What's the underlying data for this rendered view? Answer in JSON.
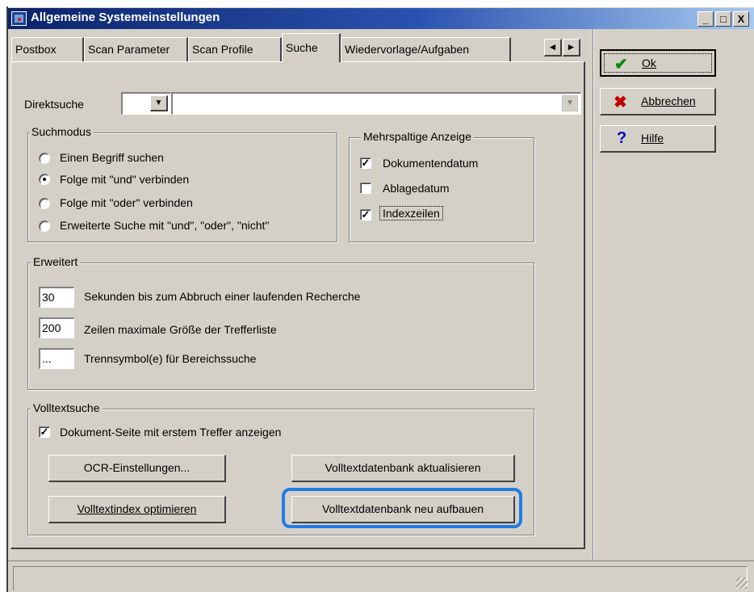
{
  "window": {
    "title": "Allgemeine Systemeinstellungen"
  },
  "caption_buttons": {
    "minimize": "_",
    "maximize": "□",
    "close": "X"
  },
  "tabs": [
    {
      "label": "Postbox",
      "active": false
    },
    {
      "label": "Scan Parameter",
      "active": false
    },
    {
      "label": "Scan Profile",
      "active": false
    },
    {
      "label": "Suche",
      "active": true
    },
    {
      "label": "Wiedervorlage/Aufgaben",
      "active": false
    }
  ],
  "tab_scroll": {
    "left": "◄",
    "right": "►"
  },
  "direktsuche": {
    "label": "Direktsuche",
    "small_value": "",
    "main_value": ""
  },
  "suchmodus": {
    "title": "Suchmodus",
    "options": [
      {
        "label": "Einen Begriff suchen",
        "selected": false
      },
      {
        "label": "Folge mit \"und\" verbinden",
        "selected": true
      },
      {
        "label": "Folge mit \"oder\" verbinden",
        "selected": false
      },
      {
        "label": "Erweiterte Suche mit \"und\", \"oder\", \"nicht\"",
        "selected": false
      }
    ]
  },
  "mehrspaltig": {
    "title": "Mehrspaltige Anzeige",
    "options": [
      {
        "label": "Dokumentendatum",
        "checked": true
      },
      {
        "label": "Ablagedatum",
        "checked": false
      },
      {
        "label": "Indexzeilen",
        "checked": true
      }
    ]
  },
  "erweitert": {
    "title": "Erweitert",
    "rows": [
      {
        "value": "30",
        "label": "Sekunden bis zum Abbruch einer laufenden Recherche"
      },
      {
        "value": "200",
        "label": "Zeilen maximale Größe der Trefferliste"
      },
      {
        "value": "...",
        "label": "Trennsymbol(e) für Bereichssuche"
      }
    ]
  },
  "volltext": {
    "title": "Volltextsuche",
    "checkbox_label": "Dokument-Seite mit erstem Treffer anzeigen",
    "checkbox_checked": true,
    "buttons": {
      "ocr": "OCR-Einstellungen...",
      "update_db": "Volltextdatenbank aktualisieren",
      "optimize": "Volltextindex optimieren",
      "rebuild": "Volltextdatenbank neu aufbauen"
    }
  },
  "actions": {
    "ok": {
      "label": "Ok",
      "icon": "checkmark-icon",
      "color": "#0a8a0a"
    },
    "cancel": {
      "label": "Abbrechen",
      "icon": "x-icon",
      "color": "#c00000"
    },
    "help": {
      "label": "Hilfe",
      "icon": "question-icon",
      "color": "#0000c0"
    }
  },
  "accent": {
    "highlight": "#1f7de6",
    "title_bar": "#0a246a"
  }
}
